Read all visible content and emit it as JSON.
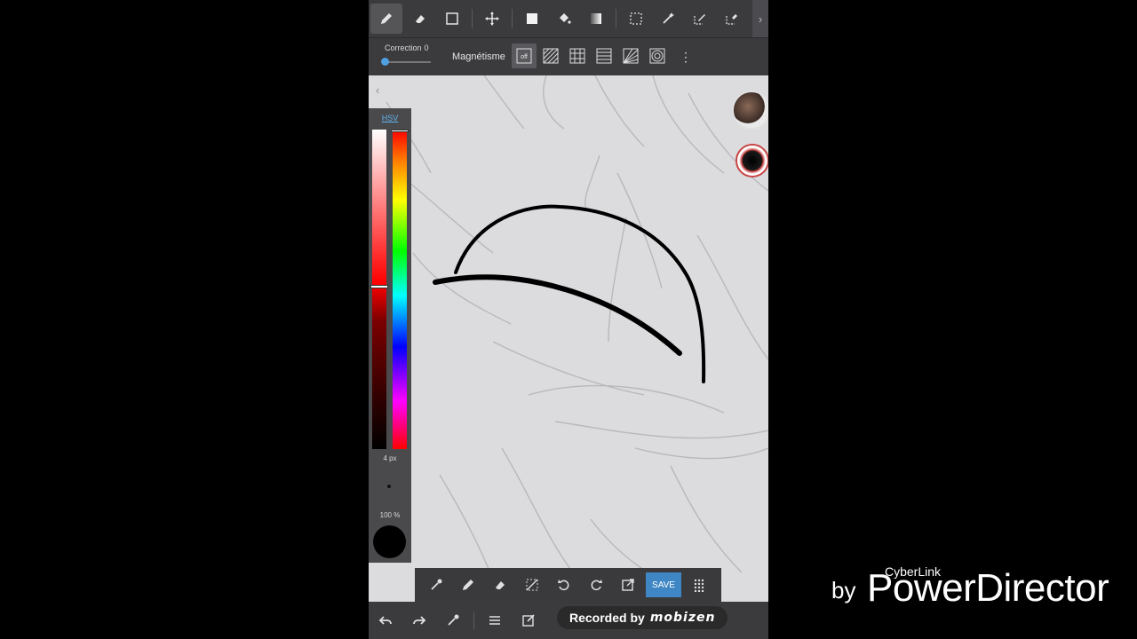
{
  "toolbar": {
    "tools": [
      "pen-icon",
      "eraser-icon",
      "square-outline-icon",
      "move-icon",
      "fill-rect-icon",
      "bucket-icon",
      "gradient-icon",
      "select-rect-icon",
      "magic-wand-icon",
      "select-pen-icon",
      "select-eraser-icon"
    ],
    "more_arrow": "›"
  },
  "subbar": {
    "correction_label": "Correction",
    "correction_value": "0",
    "correction_level": 0,
    "magnetism_label": "Magnétisme",
    "magnet_off_label": "off",
    "more": "⋮"
  },
  "color_panel": {
    "collapse": "‹",
    "mode": "HSV",
    "brush_size": "4 px",
    "opacity": "100 %",
    "current_color": "#000000"
  },
  "float_toolbar": {
    "save_label": "SAVE"
  },
  "bottom_bar": {
    "recorded_label": "Recorded by",
    "recorded_brand": "mobizen"
  },
  "watermark": {
    "by": "by",
    "small": "CyberLink",
    "big": "PowerDirector"
  }
}
